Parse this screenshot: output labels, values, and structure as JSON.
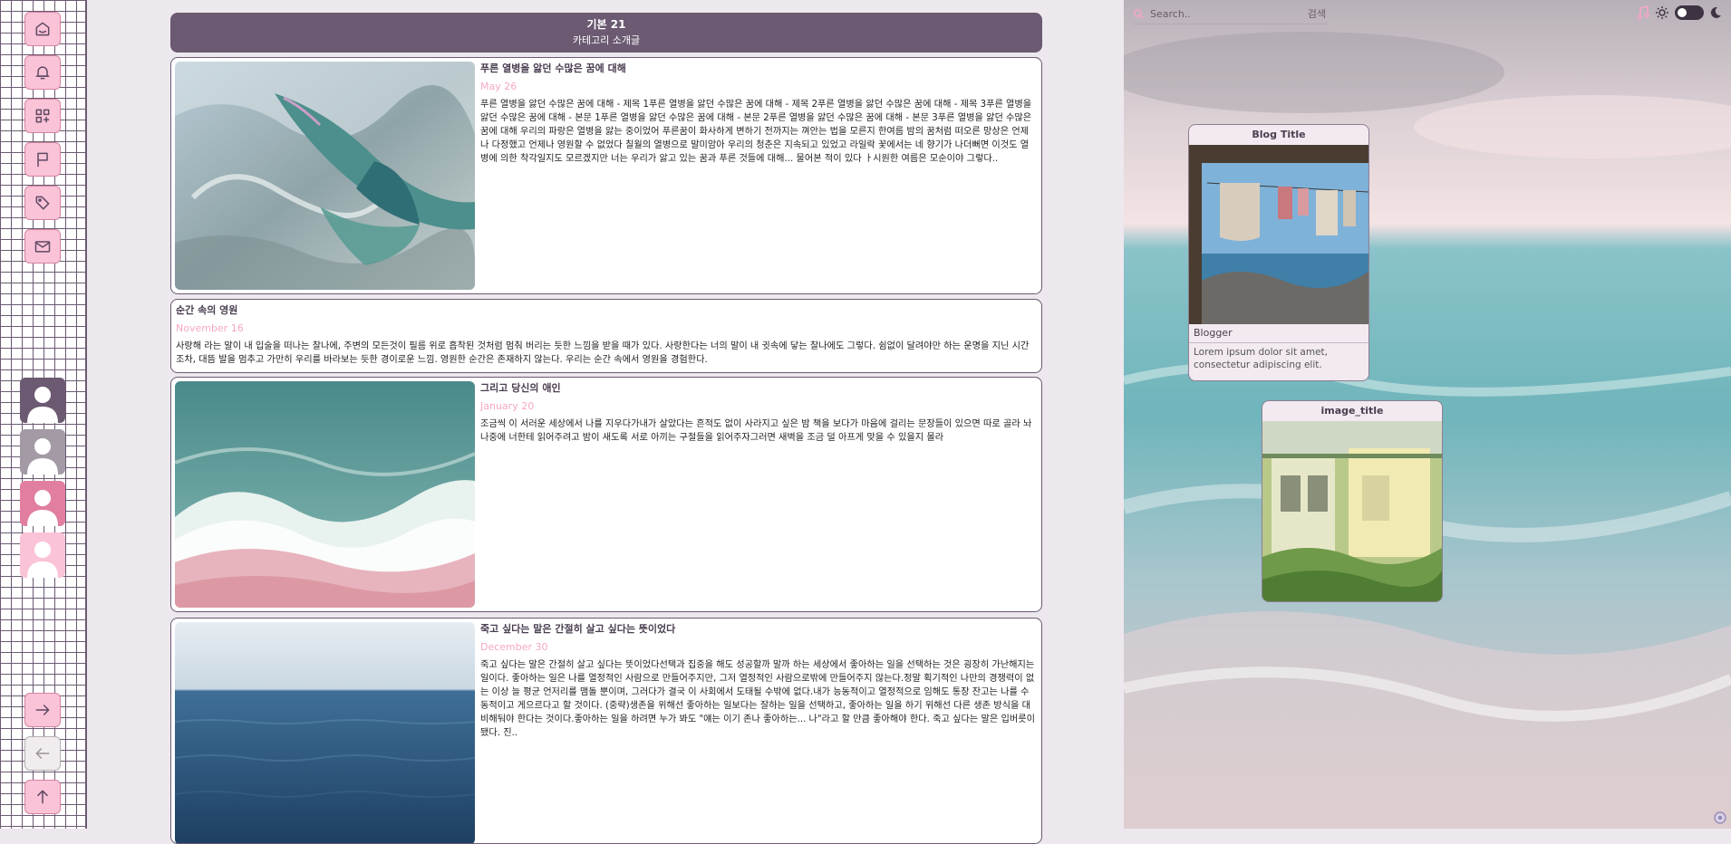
{
  "sidebar": {
    "nav_icons": [
      "home-icon",
      "bell-icon",
      "grid-icon",
      "flag-icon",
      "tag-icon",
      "mail-icon"
    ],
    "avatar_colors": [
      "#6b5a72",
      "#a39aa6",
      "#e27fa1",
      "#fbc3d8"
    ],
    "bottom_icons": [
      "arrow-right-icon",
      "arrow-left-icon",
      "arrow-up-icon"
    ]
  },
  "category": {
    "name": "기본 21",
    "subtitle": "카테고리 소개글"
  },
  "posts": [
    {
      "title": "푸른 열병을 앓던 수많은 꿈에 대해",
      "date": "May 26",
      "excerpt": "푸른 열병을 앓던 수많은 꿈에 대해 - 제목 1푸른 열병을 앓던 수많은 꿈에 대해 - 제목 2푸른 열병을 앓던 수많은 꿈에 대해 - 제목 3푸른 열병을 앓던 수많은 꿈에 대해 - 본문 1푸른 열병을 앓던 수많은 꿈에 대해 - 본문 2푸른 열병을 앓던 수많은 꿈에 대해 - 본문 3푸른 열병을 앓던 수많은 꿈에 대해 우리의 파랑은 열병을 앓는 중이었어 푸른꿈이 화사하게 변하기 전까지는 껴안는 법을 모른지 한여름 밤의 꿈처럼 떠오른 망상은 언제나 다정했고 언제나 영원할 수 없었다 칠월의 열병으로 말미암아 우리의 청춘은 지속되고 있었고 라일락 꽃에서는 네 향기가 나더뻐면 이것도 열병에 의한 착각일지도 모르겠지만 너는 우리가 앓고 있는 꿈과 푸른 것들에 대해... 물어본 적이 있다 ㅏ시원한 여름은 모순이야 그렇다.."
    },
    {
      "title": "순간 속의 영원",
      "date": "November 16",
      "excerpt": "사랑해 라는 말이 내 입술을 떠나는 찰나에, 주변의 모든것이 필름 위로 흡착된 것처럼 멈춰 버리는 듯한 느낌을 받을 때가 있다. 사랑한다는 너의 말이 내 귓속에 닿는 찰나에도 그렇다. 쉼없이 달려야만 하는 운명을 지닌 시간조차, 대뜸 발을 멈추고 가만히 우리를 바라보는 듯한 경이로운 느낌. 영원한 순간은 존재하지 않는다. 우리는 순간 속에서 영원을 경험한다."
    },
    {
      "title": "그리고 당신의 애인",
      "date": "January 20",
      "excerpt": "조금씩 이 서러운 세상에서 나를 지우다가내가 살았다는 흔적도 없이 사라지고 싶은 밤 책을 보다가 마음에 걸리는 문장들이 있으면 따로 골라 놔나중에 너한테 읽어주려고 밤이 새도록 서로 아끼는 구절들을 읽어주자그러면 새벽을 조금 덜 아프게 맞을 수 있을지 몰라"
    },
    {
      "title": "죽고 싶다는 말은 간절히 살고 싶다는 뜻이었다",
      "date": "December 30",
      "excerpt": "죽고 싶다는 말은 간절히 살고 싶다는 뜻이었다선택과 집중을 해도 성공할까 말까 하는 세상에서 좋아하는 일을 선택하는 것은 굉장히 가난해지는 일이다. 좋아하는 일은 나를 열정적인 사람으로 만들어주지만, 그저 열정적인 사람으로밖에 만들어주지 않는다.정말 획기적인 나만의 경쟁력이 없는 이상 늘 평균 언저리를 맴돌 뿐이며, 그러다가 결국 이 사회에서 도태될 수밖에 없다.내가 능동적이고 열정적으로 임해도 통장 잔고는 나를 수동적이고 게으르다고 할 것이다. (중략)생존을 위해선 좋아하는 일보다는 잘하는 일을 선택하고, 좋아하는 일을 하기 위해선 다른 생존 방식을 대비해둬야 한다는 것이다.좋아하는 일을 하려면 누가 봐도 \"얘는 이기 존나 좋아하는... 나\"라고 할 만큼 좋아해야 한다. 죽고 싶다는 말은 입버릇이 됐다. 진.."
    }
  ],
  "search": {
    "placeholder": "Search..",
    "button_label": "검색"
  },
  "header_icons": [
    "music-icon",
    "sun-icon",
    "toggle-switch",
    "moon-icon"
  ],
  "blog_widget": {
    "title": "Blog Title",
    "blogger": "Blogger",
    "description": "Lorem ipsum dolor sit amet, consectetur adipiscing elit."
  },
  "image_widget": {
    "title": "image_title"
  },
  "colors": {
    "accent": "#6b5a72",
    "pink": "#fbc3d8",
    "date_pink": "#f5a7c7"
  }
}
